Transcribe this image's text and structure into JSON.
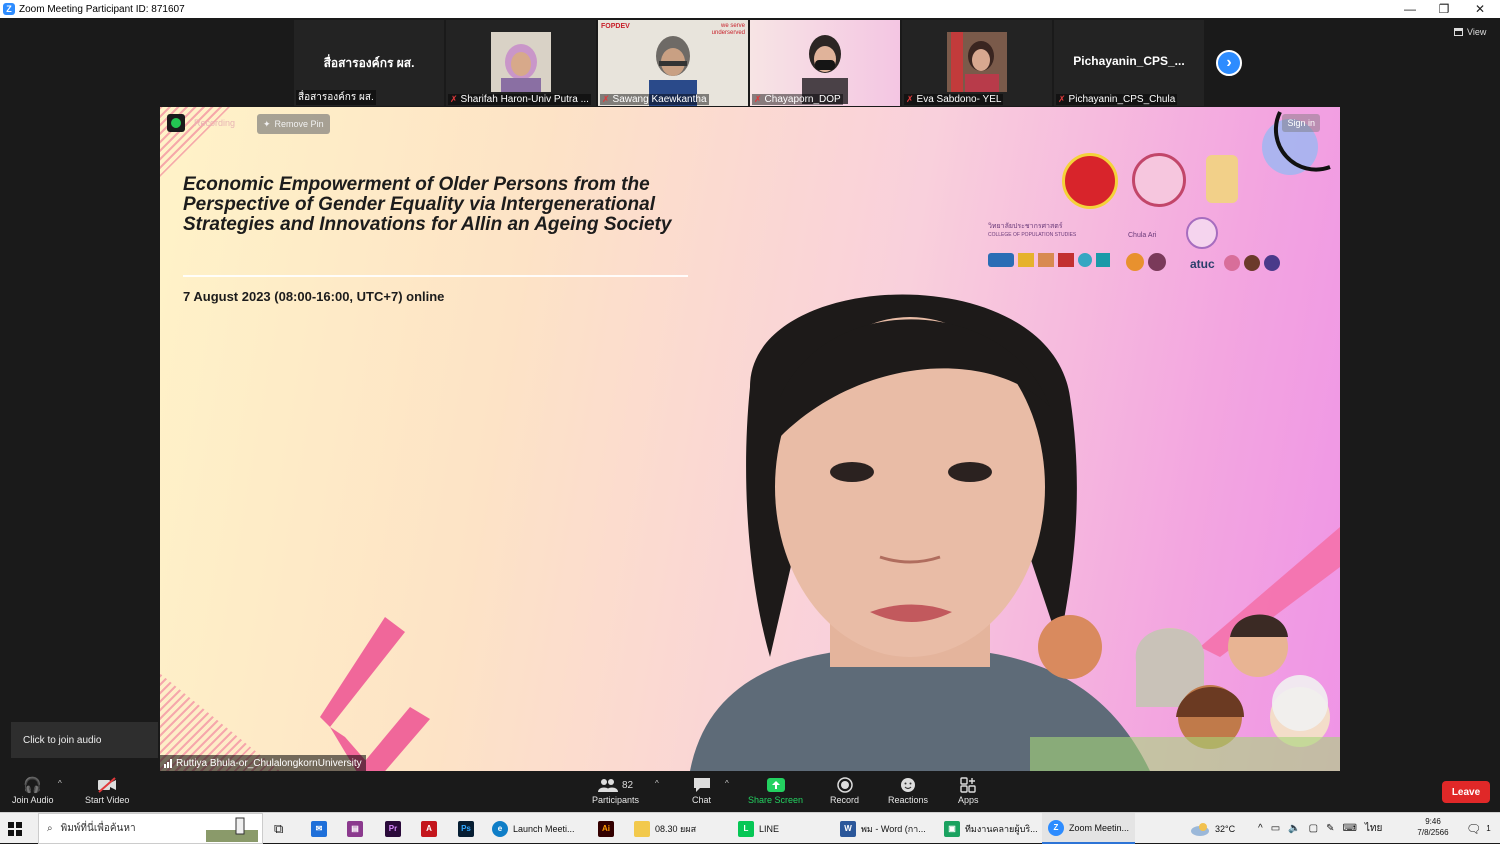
{
  "window": {
    "title": "Zoom Meeting Participant ID: 871607",
    "app_icon": "Z",
    "minimize": "—",
    "restore": "❐",
    "close": "✕"
  },
  "thumbnails": [
    {
      "big_name": "สื่อสารองค์กร ผส.",
      "caption": "สื่อสารองค์กร ผส.",
      "muted": false
    },
    {
      "caption": "Sharifah Haron-Univ Putra ...",
      "muted": true
    },
    {
      "caption": "Sawang Kaewkantha",
      "muted": true,
      "screen_label": "FOPDEV",
      "screen_label2": "we serve underserved"
    },
    {
      "caption": "Chayaporn_DOP",
      "muted": true
    },
    {
      "caption": "Eva Sabdono- YEL",
      "muted": true
    },
    {
      "big_name": "Pichayanin_CPS_...",
      "caption": "Pichayanin_CPS_Chula",
      "muted": true
    }
  ],
  "view_button": "View",
  "main_video": {
    "recording_label": "Recording",
    "remove_pin": "Remove Pin",
    "sign_in": "Sign in",
    "slide_title": "Economic Empowerment of Older Persons from the Perspective of Gender Equality via Intergenerational Strategies and Innovations for Allin an Ageing Society",
    "slide_date": "7 August 2023 (08:00-16:00, UTC+7) online",
    "logo_text_college": "วิทยาลัยประชากรศาสตร์",
    "logo_text_college_en": "COLLEGE OF POPULATION STUDIES",
    "logo_text_chula": "Chula Ari",
    "logo_text_atuc": "atuc",
    "speaker_name": "Ruttiya Bhula-or_ChulalongkornUniversity"
  },
  "tooltip": "Click to join audio",
  "toolbar": {
    "join_audio": "Join Audio",
    "start_video": "Start Video",
    "participants": "Participants",
    "participants_count": "82",
    "chat": "Chat",
    "share_screen": "Share Screen",
    "record": "Record",
    "reactions": "Reactions",
    "apps": "Apps",
    "leave": "Leave"
  },
  "taskbar": {
    "search_placeholder": "พิมพ์ที่นี่เพื่อค้นหา",
    "items": [
      {
        "label": "Launch Meeti..."
      },
      {
        "label": "08.30 ยผส"
      },
      {
        "label": "LINE"
      },
      {
        "label": "พม - Word (กา..."
      },
      {
        "label": "ทีมงานคลายผู้บริ..."
      },
      {
        "label": "Zoom Meetin..."
      }
    ],
    "temperature": "32°C",
    "language": "ไทย",
    "time": "9:46",
    "date": "7/8/2566",
    "notification_count": "1"
  },
  "colors": {
    "zoom_blue": "#2d8cff",
    "share_green": "#23d160",
    "leave_red": "#e02828",
    "mute_red": "#e0393b"
  }
}
